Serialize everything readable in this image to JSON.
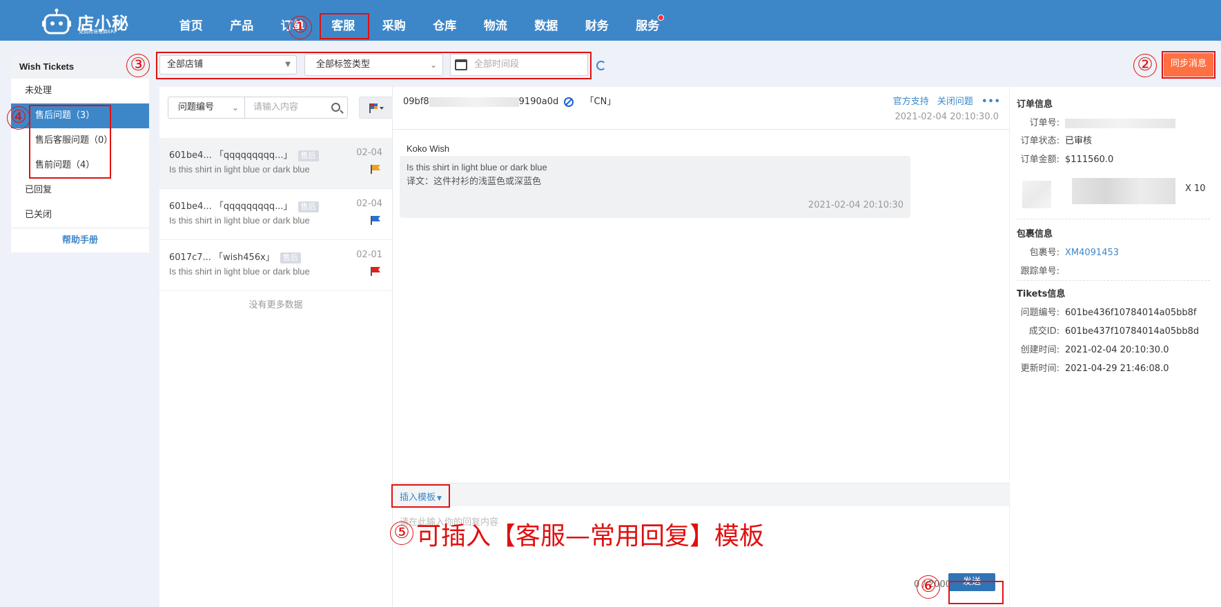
{
  "app": {
    "brand": "店小秘",
    "slogan": "免费跨境电商ERP"
  },
  "nav": {
    "items": [
      "首页",
      "产品",
      "订单",
      "客服",
      "采购",
      "仓库",
      "物流",
      "数据",
      "财务",
      "服务"
    ],
    "active": "客服"
  },
  "sidebar": {
    "title": "Wish Tickets",
    "items": [
      {
        "label": "未处理"
      },
      {
        "label": "售后问题（3）"
      },
      {
        "label": "售后客服问题（0）"
      },
      {
        "label": "售前问题（4）"
      },
      {
        "label": "已回复"
      },
      {
        "label": "已关闭"
      }
    ],
    "help": "帮助手册"
  },
  "filters": {
    "store": "全部店铺",
    "tag_type": "全部标签类型",
    "time_placeholder": "全部时间段"
  },
  "sync_button": "同步消息",
  "list": {
    "issue_select": "问题编号",
    "search_placeholder": "请输入内容",
    "rows": [
      {
        "title": "601be4...  「qqqqqqqqq...」",
        "tag": "售后",
        "date": "02-04",
        "message": "Is this shirt in light blue or dark blue",
        "flag_color": "#f0a020"
      },
      {
        "title": "601be4...  「qqqqqqqqq...」",
        "tag": "售后",
        "date": "02-04",
        "message": "Is this shirt in light blue or dark blue",
        "flag_color": "#2a6fd6"
      },
      {
        "title": "6017c7...  「wish456x」",
        "tag": "售后",
        "date": "02-01",
        "message": "Is this shirt in light blue or dark blue",
        "flag_color": "#e02020"
      }
    ],
    "no_more": "没有更多数据"
  },
  "chat": {
    "ticket_id_start": "09bf8",
    "ticket_id_end": "9190a0d",
    "country": "「CN」",
    "official_support": "官方支持",
    "close_issue": "关闭问题",
    "more": "•••",
    "header_time": "2021-02-04 20:10:30.0",
    "sender": "Koko Wish",
    "message_line1": "Is this shirt in light blue or dark blue",
    "message_line2": "译文：这件衬衫的浅蓝色或深蓝色",
    "message_time": "2021-02-04 20:10:30",
    "insert_template": "插入模板",
    "reply_placeholder": "请在此输入你的回复内容",
    "char_count": "0 / 2000",
    "send": "发送"
  },
  "info": {
    "order_title": "订单信息",
    "order_no_label": "订单号:",
    "order_status_label": "订单状态:",
    "order_status": "已审核",
    "order_amount_label": "订单金额:",
    "order_amount": "$111560.0",
    "qty": "X 10",
    "package_title": "包裹信息",
    "package_no_label": "包裹号:",
    "package_no": "XM4091453",
    "tracking_label": "跟踪单号:",
    "tickets_title": "Tikets信息",
    "issue_no_label": "问题编号:",
    "issue_no": "601be436f10784014a05bb8f",
    "deal_id_label": "成交ID:",
    "deal_id": "601be437f10784014a05bb8d",
    "created_label": "创建时间:",
    "created": "2021-02-04 20:10:30.0",
    "updated_label": "更新时间:",
    "updated": "2021-04-29 21:46:08.0"
  },
  "annotations": {
    "n1": "①",
    "n2": "②",
    "n3": "③",
    "n4": "④",
    "n5": "⑤",
    "n6": "⑥",
    "note5": "可插入【客服—常用回复】模板"
  },
  "colors": {
    "primary": "#3d87c9",
    "sync": "#ff7043",
    "send": "#2f74b5",
    "annotation": "#e01010"
  }
}
